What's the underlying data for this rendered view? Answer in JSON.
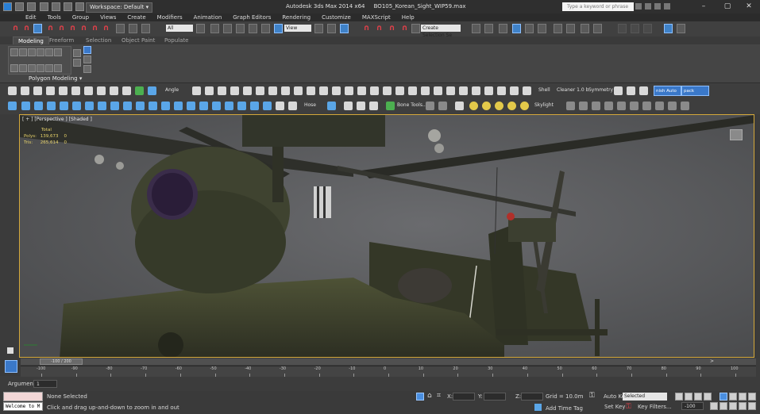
{
  "titlebar": {
    "workspace": "Workspace: Default",
    "app": "Autodesk 3ds Max  2014 x64",
    "file": "BO105_Korean_Sight_WIP59.max",
    "search_placeholder": "Type a keyword or phrase"
  },
  "menu": [
    "Edit",
    "Tools",
    "Group",
    "Views",
    "Create",
    "Modifiers",
    "Animation",
    "Graph Editors",
    "Rendering",
    "Customize",
    "MAXScript",
    "Help"
  ],
  "toolbar": {
    "selection_filter": "All",
    "ref_coord": "View",
    "named_selection": "Create Selection Se"
  },
  "ribbon": {
    "tabs": [
      "Modeling",
      "Freeform",
      "Selection",
      "Object Paint",
      "Populate"
    ],
    "panel_label": "Polygon Modeling"
  },
  "modifier_row": {
    "angle": "Angle",
    "shell": "Shell",
    "cleaner": "Cleaner 1.0 b",
    "symmetry": "Symmetry",
    "btn1": "nish Auto Re",
    "btn2": "pack Mesh Inspe"
  },
  "shape_row": {
    "hose": "Hose",
    "bone_tools": "Bone Tools...",
    "skylight": "Skylight"
  },
  "viewport": {
    "label": "[ + ] [Perspective ] [Shaded ]",
    "stats": {
      "header": "Total",
      "polys_label": "Polys:",
      "polys_value": "139,673",
      "polys_sel": "0",
      "tris_label": "Tris:",
      "tris_value": "265,614",
      "tris_sel": "0"
    }
  },
  "timeline": {
    "frame": "-100 / 200",
    "ticks": [
      "-100",
      "-90",
      "-80",
      "-70",
      "-60",
      "-50",
      "-40",
      "-30",
      "-20",
      "-10",
      "0",
      "10",
      "20",
      "30",
      "40",
      "50",
      "60",
      "70",
      "80",
      "90",
      "100"
    ]
  },
  "argument": {
    "label": "Argument",
    "value": "1"
  },
  "status": {
    "selection": "None Selected",
    "prompt": "Click and drag up-and-down to zoom in and out",
    "welcome": "Welcome to M",
    "x_label": "X:",
    "y_label": "Y:",
    "z_label": "Z:",
    "grid": "Grid = 10.0m",
    "add_time_tag": "Add Time Tag",
    "auto_key": "Auto Key",
    "auto_key_value": "Selected",
    "set_key": "Set Key",
    "key_filters": "Key Filters...",
    "frame_field": "-100"
  },
  "colors": {
    "accent_blue": "#3f82c8",
    "viewport_border": "#d4a83a",
    "magnet_red": "#e0404a",
    "stats_yellow": "#e8d36a"
  }
}
